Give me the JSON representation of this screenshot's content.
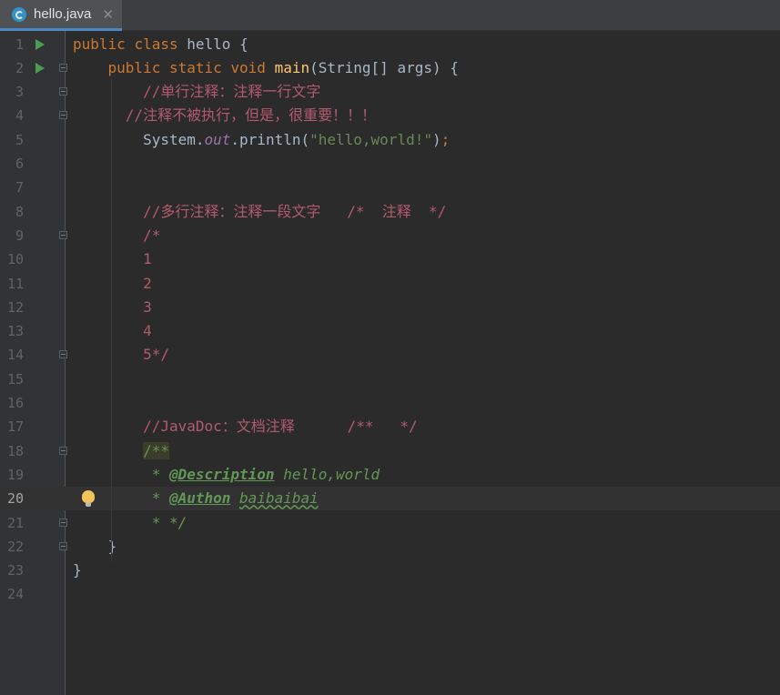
{
  "tab": {
    "label": "hello.java",
    "close": "✕",
    "file_icon": "java-class-icon"
  },
  "current_line": 20,
  "lines": [
    {
      "n": "1",
      "run": true,
      "fold": false
    },
    {
      "n": "2",
      "run": true,
      "fold": true
    },
    {
      "n": "3",
      "run": false,
      "fold": true
    },
    {
      "n": "4",
      "run": false,
      "fold": true
    },
    {
      "n": "5",
      "run": false,
      "fold": false
    },
    {
      "n": "6",
      "run": false,
      "fold": false
    },
    {
      "n": "7",
      "run": false,
      "fold": false
    },
    {
      "n": "8",
      "run": false,
      "fold": false
    },
    {
      "n": "9",
      "run": false,
      "fold": true
    },
    {
      "n": "10",
      "run": false,
      "fold": false
    },
    {
      "n": "11",
      "run": false,
      "fold": false
    },
    {
      "n": "12",
      "run": false,
      "fold": false
    },
    {
      "n": "13",
      "run": false,
      "fold": false
    },
    {
      "n": "14",
      "run": false,
      "fold": true
    },
    {
      "n": "15",
      "run": false,
      "fold": false
    },
    {
      "n": "16",
      "run": false,
      "fold": false
    },
    {
      "n": "17",
      "run": false,
      "fold": false
    },
    {
      "n": "18",
      "run": false,
      "fold": true
    },
    {
      "n": "19",
      "run": false,
      "fold": false
    },
    {
      "n": "20",
      "run": false,
      "fold": false,
      "bulb": true
    },
    {
      "n": "21",
      "run": false,
      "fold": true
    },
    {
      "n": "22",
      "run": false,
      "fold": true
    },
    {
      "n": "23",
      "run": false,
      "fold": false
    },
    {
      "n": "24",
      "run": false,
      "fold": false
    }
  ],
  "code": {
    "l1_kw1": "public",
    "l1_kw2": "class",
    "l1_name": "hello",
    "l1_brace": "{",
    "l2_kw1": "public",
    "l2_kw2": "static",
    "l2_kw3": "void",
    "l2_fn": "main",
    "l2_params": "(String[] args) {",
    "l3": "//单行注释：注释一行文字",
    "l4": "//注释不被执行，但是，很重要！！！",
    "l5_a": "System.",
    "l5_out": "out",
    "l5_b": ".println(",
    "l5_str": "\"hello,world!\"",
    "l5_c": ")",
    "l5_semi": ";",
    "l8": "//多行注释：注释一段文字   /*  注释  */",
    "l9": "/*",
    "l10": "1",
    "l11": "2",
    "l12": "3",
    "l13": "4",
    "l14": "5*/",
    "l17": "//JavaDoc：文档注释      /**   */",
    "l18": "/**",
    "l19_star": " * ",
    "l19_tag": "@Description",
    "l19_val": " hello,world",
    "l20_star": " * ",
    "l20_tag": "@Authon",
    "l20_val": "baibaibai",
    "l21": " * */",
    "l22": "}",
    "l23": "}"
  }
}
